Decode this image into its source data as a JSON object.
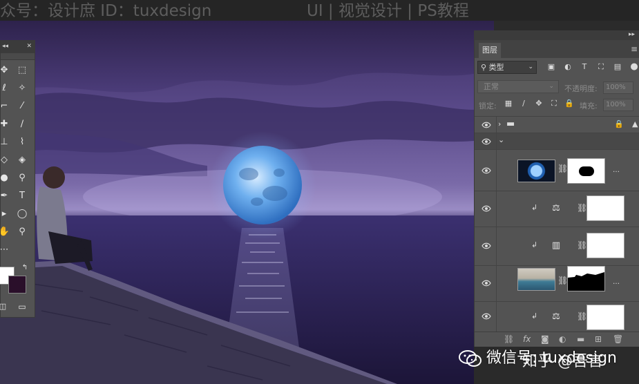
{
  "topbar": {
    "left_text": "众号：设计庶  ID：tuxdesign",
    "right_text": "UI | 视觉设计 | PS教程"
  },
  "tools_panel": {
    "collapse_label": "◂◂",
    "close_label": "✕",
    "foreground_color": "#ffffff",
    "background_color": "#2a0f2a"
  },
  "layers_panel": {
    "collapse_label": "▸▸",
    "tab_label": "图层",
    "filter": {
      "kind_label": "类型"
    },
    "blend_mode": "正常",
    "opacity_label": "不透明度:",
    "opacity_value": "100%",
    "lock_label": "锁定:",
    "fill_label": "填充:",
    "fill_value": "100%",
    "layers": [
      {
        "name": "group-folder-closed",
        "type": "group",
        "locked": true
      },
      {
        "name": "group-open",
        "type": "group-open"
      },
      {
        "name": "moon-layer",
        "type": "image-with-mask",
        "thumbnail": "moon"
      },
      {
        "name": "balance-adjustment-1",
        "type": "adjustment",
        "icon": "color-balance-icon",
        "clipped": true
      },
      {
        "name": "gradient-map-adjustment",
        "type": "adjustment",
        "icon": "gradient-map-icon",
        "clipped": true
      },
      {
        "name": "scene-layer",
        "type": "image-with-mask",
        "thumbnail": "scene"
      },
      {
        "name": "balance-adjustment-2",
        "type": "adjustment",
        "icon": "color-balance-icon",
        "clipped": true
      }
    ]
  },
  "watermark": {
    "text": "微信号: tuxdesign",
    "overlay_text": "知乎 @吾言"
  },
  "colors": {
    "panel_bg": "#535353",
    "panel_header": "#3b3b3b",
    "canvas_sky": "#5a4a8a",
    "moon": "#5aa0e6"
  }
}
